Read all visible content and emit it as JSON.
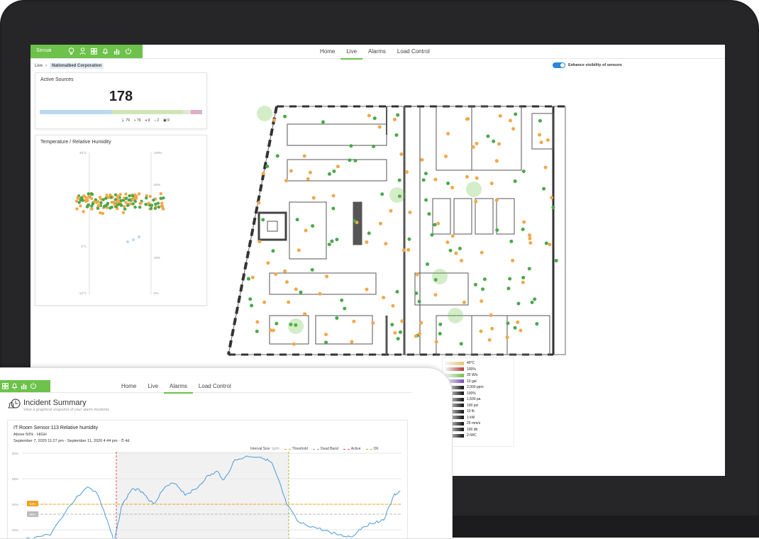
{
  "brand": {
    "name": "Sensai",
    "color": "#6cc24a"
  },
  "nav": {
    "items": [
      "Home",
      "Live",
      "Alarms",
      "Load Control"
    ],
    "active": "Live"
  },
  "breadcrumb": {
    "root": "Live",
    "current": "Nationalbed Corporation"
  },
  "enhance_toggle": {
    "label": "Enhance visibility of sensors",
    "on": true
  },
  "active_sources": {
    "title": "Active Sources",
    "count": "178",
    "bar_segments": [
      {
        "color": "#b9d8f2",
        "fraction": 0.44
      },
      {
        "color": "#cfe6b6",
        "fraction": 0.44
      },
      {
        "color": "#dfe9d5",
        "fraction": 0.05
      },
      {
        "color": "#e8a9c9",
        "fraction": 0.05
      },
      {
        "color": "#bfbfbf",
        "fraction": 0.02
      }
    ],
    "stats": [
      {
        "icon": "thermometer-icon",
        "value": "79"
      },
      {
        "icon": "droplet-icon",
        "value": "79"
      },
      {
        "icon": "location-pin-icon",
        "value": "9"
      },
      {
        "icon": "sensor-icon",
        "value": "2"
      },
      {
        "icon": "meter-icon",
        "value": "9"
      }
    ]
  },
  "temp_humidity": {
    "title": "Temperature / Relative Humidity",
    "left_ticks": [
      "40°C",
      "0°C",
      "-10°C"
    ],
    "right_ticks": [
      "100%",
      "50%",
      "25%",
      "0%"
    ]
  },
  "legend_ranges": [
    "40°C",
    "100%",
    "25 W/s",
    "10 gal",
    "2,000 ppm",
    "100%",
    "1,500 pa",
    "100 psi",
    "10 lb",
    "1 kW",
    "25 mm/s",
    "100 db",
    "2 iWC"
  ],
  "legend_colors": [
    "#e9c46a",
    "#b83a3a",
    "#6cc24a",
    "#7b4db8",
    "#111111",
    "#111111",
    "#111111",
    "#111111",
    "#111111",
    "#111111",
    "#111111",
    "#111111",
    "#111111"
  ],
  "tablet": {
    "nav": {
      "items": [
        "Home",
        "Live",
        "Alarms",
        "Load Control"
      ],
      "active": "Alarms"
    },
    "incident": {
      "title": "Incident Summary",
      "subtitle": "View a graphical snapshot of your alarm incidents"
    },
    "chart": {
      "title": "IT Room Sensor 113 Relative humidity",
      "condition": "Above 50% · HIGH",
      "date_range": "September 7, 2020 11:27 pm - September 11, 2020 4:44 pm · ⏱ 4d",
      "legend": {
        "interval": "Interval Size",
        "interval_value": "1g/m",
        "threshold": "Threshold",
        "dead_band": "Dead Band",
        "active": "Active",
        "ok": "OK"
      },
      "y_ticks": [
        "60%",
        "55%",
        "50%",
        "45%"
      ],
      "threshold_label": "53%",
      "deadband_label": "50%"
    }
  }
}
